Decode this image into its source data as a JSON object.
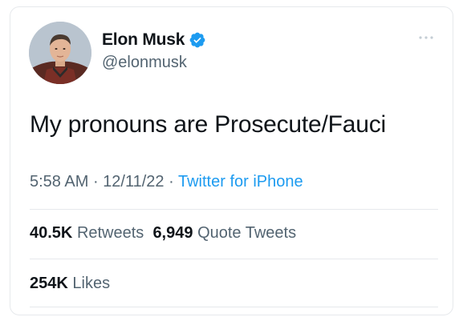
{
  "author": {
    "name": "Elon Musk",
    "handle": "@elonmusk",
    "verified": true
  },
  "tweet": {
    "text": "My pronouns are Prosecute/Fauci",
    "time": "5:58 AM",
    "separator": "·",
    "date": "12/11/22",
    "source": "Twitter for iPhone"
  },
  "stats": {
    "retweets_count": "40.5K",
    "retweets_label": "Retweets",
    "quote_tweets_count": "6,949",
    "quote_tweets_label": "Quote Tweets",
    "likes_count": "254K",
    "likes_label": "Likes"
  },
  "icons": {
    "verified": "verified-badge-icon",
    "more": "more-options-icon"
  },
  "colors": {
    "text_primary": "#0f1419",
    "text_secondary": "#536471",
    "link": "#1d9bf0",
    "verified": "#1d9bf0",
    "border": "#e6e9ec"
  }
}
